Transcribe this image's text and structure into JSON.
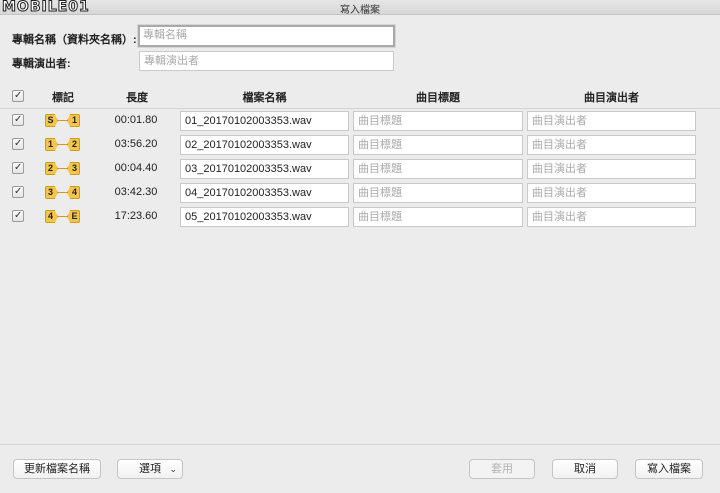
{
  "window": {
    "title": "寫入檔案",
    "logo_text": "MOBILE01"
  },
  "album": {
    "name_label": "專輯名稱（資料夾名稱）:",
    "name_placeholder": "專輯名稱",
    "artist_label": "專輯演出者:",
    "artist_placeholder": "專輯演出者"
  },
  "table": {
    "headers": {
      "mark": "標記",
      "length": "長度",
      "filename": "檔案名稱",
      "song_title": "曲目標題",
      "song_artist": "曲目演出者"
    },
    "title_placeholder": "曲目標題",
    "artist_placeholder": "曲目演出者",
    "rows": [
      {
        "checked": true,
        "mark_start": "S",
        "mark_end": "1",
        "length": "00:01.80",
        "filename": "01_20170102003353.wav"
      },
      {
        "checked": true,
        "mark_start": "1",
        "mark_end": "2",
        "length": "03:56.20",
        "filename": "02_20170102003353.wav"
      },
      {
        "checked": true,
        "mark_start": "2",
        "mark_end": "3",
        "length": "00:04.40",
        "filename": "03_20170102003353.wav"
      },
      {
        "checked": true,
        "mark_start": "3",
        "mark_end": "4",
        "length": "03:42.30",
        "filename": "04_20170102003353.wav"
      },
      {
        "checked": true,
        "mark_start": "4",
        "mark_end": "E",
        "length": "17:23.60",
        "filename": "05_20170102003353.wav"
      }
    ]
  },
  "buttons": {
    "update_names": "更新檔案名稱",
    "options": "選項",
    "apply": "套用",
    "cancel": "取消",
    "write": "寫入檔案"
  }
}
